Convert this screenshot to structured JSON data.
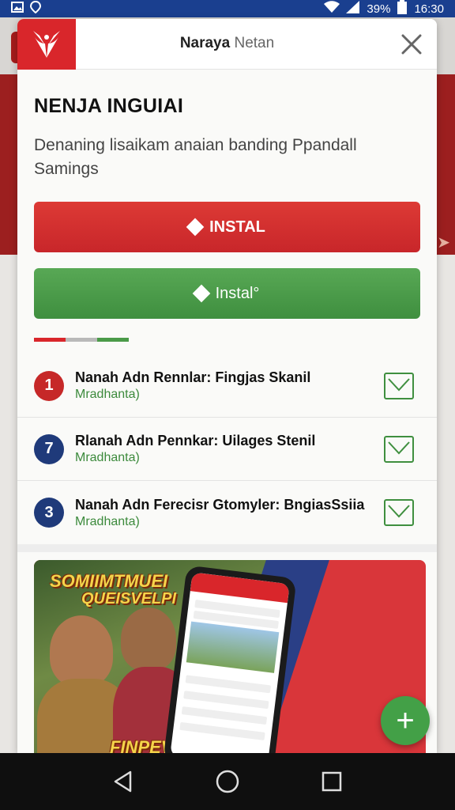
{
  "status_bar": {
    "battery_text": "39%",
    "time": "16:30",
    "icons": [
      "image-icon",
      "location-icon",
      "wifi-icon",
      "signal-icon",
      "battery-icon"
    ]
  },
  "modal": {
    "title_bold": "Naraya",
    "title_light": "Netan",
    "heading": "NENJA INGUIAI",
    "subtext": "Denaning lisaikam anaian banding Ppandall Samings",
    "btn_red_label": "INSTAL",
    "btn_green_label": "Instal°",
    "tab_colors": [
      "#d9262b",
      "#b9b9b9",
      "#4a9a48"
    ]
  },
  "list": [
    {
      "number": "1",
      "title": "Nanah Adn Rennlar: Fingjas Skanil",
      "sub": "Mradhanta)",
      "badge_color": "#c62828"
    },
    {
      "number": "7",
      "title": "Rlanah Adn Pennkar: Uilages Stenil",
      "sub": "Mradhanta)",
      "badge_color": "#1f3a7a"
    },
    {
      "number": "3",
      "title": "Nanah Adn Ferecisr Gtomyler: BngiasSsiia",
      "sub": "Mradhanta)",
      "badge_color": "#1f3a7a"
    }
  ],
  "promo": {
    "top_line1": "SOMIIMTMUEI",
    "top_line2": "QUEISVELPI",
    "bottom": "FINPEVI"
  },
  "fab_label": "+",
  "colors": {
    "brand_red": "#d9262b",
    "brand_green": "#43a047",
    "navy": "#1f3a7a"
  }
}
